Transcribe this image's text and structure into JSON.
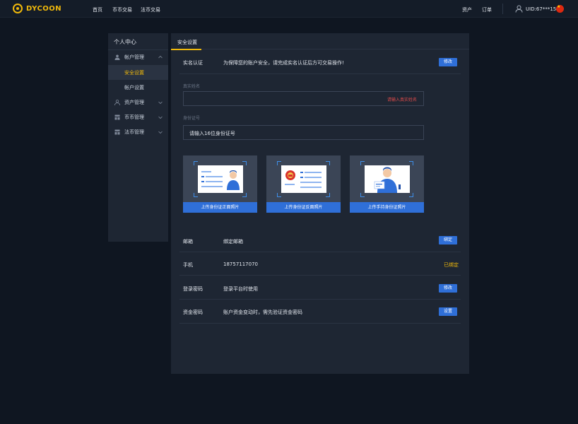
{
  "brand": {
    "name": "DYCOON"
  },
  "nav": {
    "items": [
      "首页",
      "币币交易",
      "法币交易"
    ]
  },
  "topbar": {
    "assets": "资产",
    "orders": "订单",
    "uid": "UID:67***15"
  },
  "sidebar": {
    "title": "个人中心",
    "groups": [
      {
        "label": "帐户管理",
        "expanded": true,
        "items": [
          "安全设置",
          "帐户设置"
        ],
        "active_item": "安全设置"
      },
      {
        "label": "资产管理",
        "expanded": false
      },
      {
        "label": "币币管理",
        "expanded": false
      },
      {
        "label": "法币管理",
        "expanded": false
      }
    ]
  },
  "main": {
    "tab": "安全设置",
    "realname": {
      "label": "实名认证",
      "desc": "为保障您的账户安全，请完成实名认证后方可交易操作!",
      "button": "修改",
      "name_field_label": "真实姓名",
      "name_placeholder": "请输入真实姓名",
      "id_field_label": "身份证号",
      "id_value": "请输入16位身份证号"
    },
    "uploads": [
      {
        "label": "上传身份证正面照片"
      },
      {
        "label": "上传身份证反面照片"
      },
      {
        "label": "上传手持身份证照片"
      }
    ],
    "rows": [
      {
        "label": "邮箱",
        "desc": "绑定邮箱",
        "button": "绑定"
      },
      {
        "label": "手机",
        "desc": "18757117070",
        "status": "已绑定"
      },
      {
        "label": "登录密码",
        "desc": "登录平台时使用",
        "button": "修改"
      },
      {
        "label": "资金密码",
        "desc": "账户资金变动时，需先验证资金密码",
        "button": "设置"
      }
    ]
  },
  "colors": {
    "accent": "#f0b90b",
    "primary_button": "#2f6fd8",
    "error": "#e04b4b",
    "background": "#0f1621",
    "panel": "#1e2633"
  }
}
